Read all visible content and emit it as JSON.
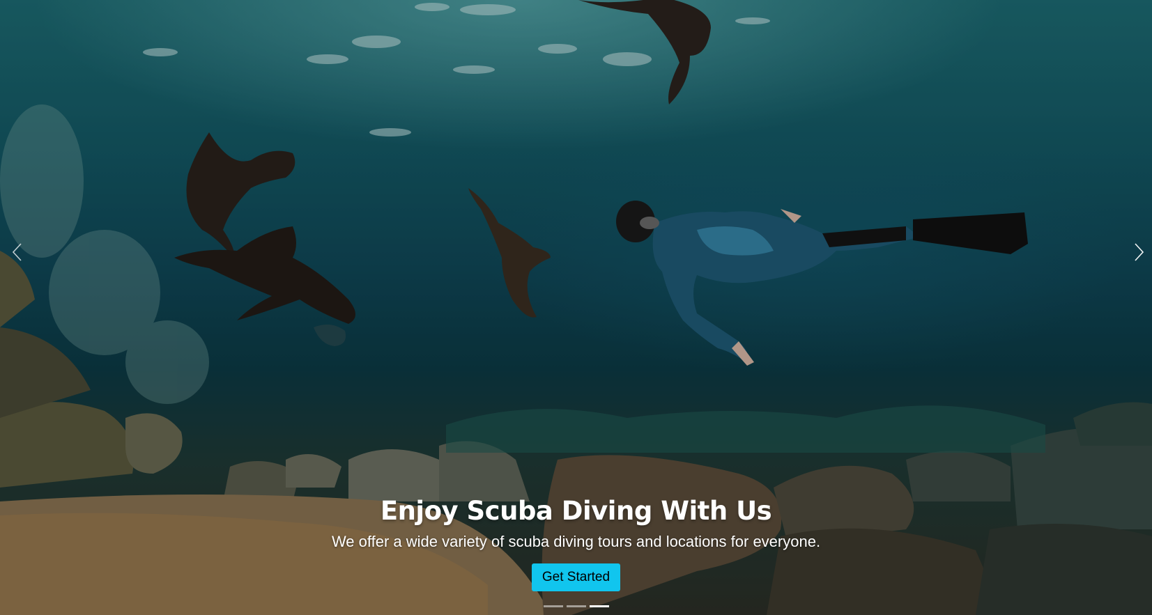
{
  "carousel": {
    "prev_label": "Previous",
    "next_label": "Next",
    "caption": {
      "title": "Enjoy Scuba Diving With Us",
      "text": "We offer a wide variety of scuba diving tours and locations for everyone.",
      "button_label": "Get Started"
    },
    "slide_count": 3,
    "active_slide": 3
  },
  "colors": {
    "button_bg": "#11c5ee",
    "button_text": "#000000",
    "caption_text": "#ffffff"
  },
  "icons": {
    "prev": "chevron-left-icon",
    "next": "chevron-right-icon"
  }
}
